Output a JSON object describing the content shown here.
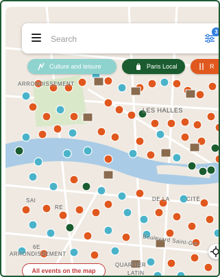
{
  "search": {
    "placeholder": "Search",
    "filter_count": "3"
  },
  "chips": [
    {
      "label": "Culture and leisure",
      "color": "#8fd3cf",
      "icon": "culture-icon"
    },
    {
      "label": "Paris Local",
      "color": "#1a5c2f",
      "icon": "bag-icon"
    },
    {
      "label": "R",
      "color": "#e0581e",
      "icon": "fork-knife-icon"
    }
  ],
  "map_labels": {
    "arrondissement_top": "ARRONDISSEMENT",
    "les_halles": "LES HALLES",
    "sai": "SAI",
    "re": "RE",
    "cite": "CITÉ",
    "de_la": "DE LA",
    "arr_6e": "6E",
    "arrondissement_bottom": "ARRONDISSEMENT",
    "quartier": "QUARTIER",
    "latin": "LATIN",
    "boulevard": "Boulevard Saint-Ger"
  },
  "buttons": {
    "all_events": "All events on the map"
  },
  "colors": {
    "restaurant": "#e0581e",
    "culture": "#4ab3c9",
    "local": "#1a5c2f",
    "water": "#a9cbe6"
  }
}
